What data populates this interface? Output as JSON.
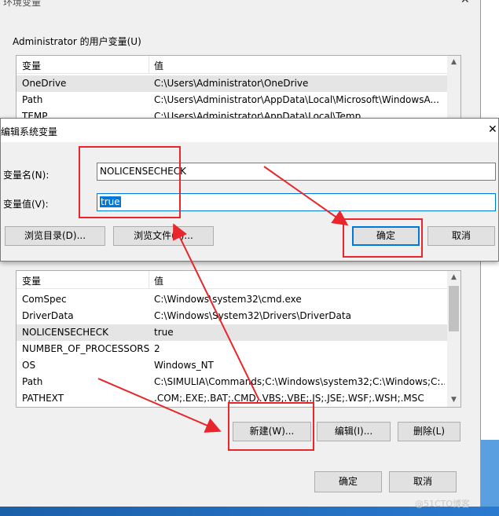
{
  "outer": {
    "title": "环境变量",
    "user_group_label": "Administrator 的用户变量(U)",
    "col_variable": "变量",
    "col_value": "值",
    "user_vars": [
      {
        "name": "OneDrive",
        "value": "C:\\Users\\Administrator\\OneDrive"
      },
      {
        "name": "Path",
        "value": "C:\\Users\\Administrator\\AppData\\Local\\Microsoft\\WindowsA..."
      },
      {
        "name": "TEMP",
        "value": "C:\\Users\\Administrator\\AppData\\Local\\Temp"
      }
    ],
    "system_vars": [
      {
        "name": "ComSpec",
        "value": "C:\\Windows\\system32\\cmd.exe"
      },
      {
        "name": "DriverData",
        "value": "C:\\Windows\\System32\\Drivers\\DriverData"
      },
      {
        "name": "NOLICENSECHECK",
        "value": "true"
      },
      {
        "name": "NUMBER_OF_PROCESSORS",
        "value": "2"
      },
      {
        "name": "OS",
        "value": "Windows_NT"
      },
      {
        "name": "Path",
        "value": "C:\\SIMULIA\\Commands;C:\\Windows\\system32;C:\\Windows;C:..."
      },
      {
        "name": "PATHEXT",
        "value": ".COM;.EXE;.BAT;.CMD;.VBS;.VBE;.JS;.JSE;.WSF;.WSH;.MSC"
      }
    ],
    "btn_new": "新建(W)...",
    "btn_edit": "编辑(I)...",
    "btn_delete": "删除(L)",
    "btn_ok": "确定",
    "btn_cancel": "取消"
  },
  "dialog": {
    "title": "编辑系统变量",
    "name_label": "变量名(N):",
    "name_value": "NOLICENSECHECK",
    "value_label": "变量值(V):",
    "value_value": "true",
    "btn_browse_dir": "浏览目录(D)...",
    "btn_browse_file": "浏览文件(F)...",
    "btn_ok": "确定",
    "btn_cancel": "取消"
  },
  "colors": {
    "annotation_red": "#e8262b",
    "focus_blue": "#0078d7",
    "selection_gray": "#e5e5e5"
  },
  "watermark": "@51CTO博客"
}
